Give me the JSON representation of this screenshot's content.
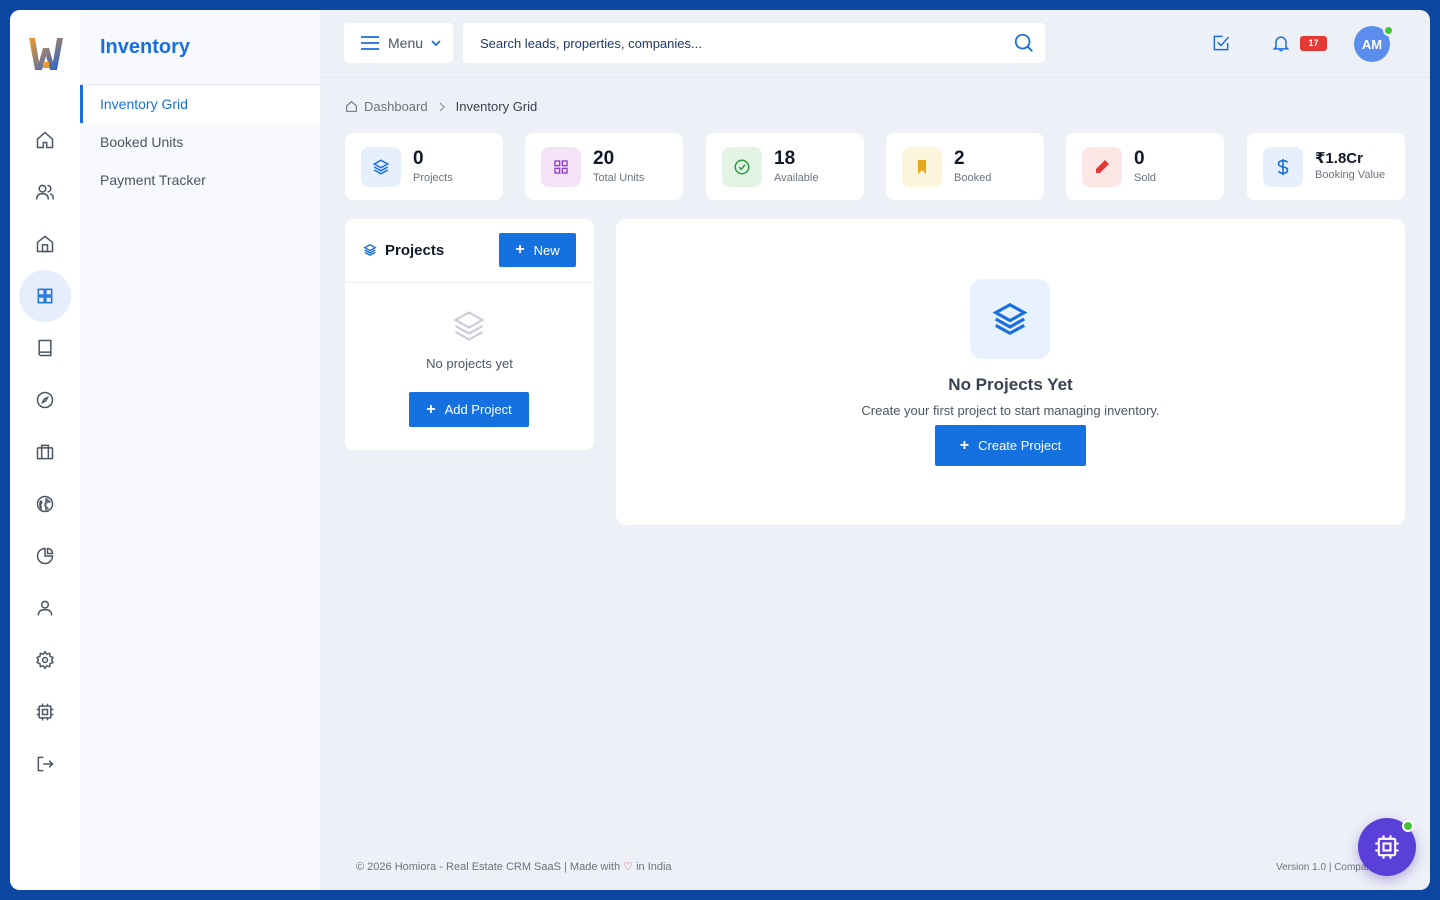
{
  "sidebar": {
    "items": [
      {
        "icon": "home-icon"
      },
      {
        "icon": "users-icon"
      },
      {
        "icon": "property-icon"
      },
      {
        "icon": "grid-icon"
      },
      {
        "icon": "book-icon"
      },
      {
        "icon": "compass-icon"
      },
      {
        "icon": "briefcase-icon"
      },
      {
        "icon": "globe-icon"
      },
      {
        "icon": "pie-chart-icon"
      },
      {
        "icon": "user-icon"
      },
      {
        "icon": "gear-icon"
      },
      {
        "icon": "chip-icon"
      },
      {
        "icon": "logout-icon"
      }
    ]
  },
  "subnav": {
    "title": "Inventory",
    "items": [
      {
        "label": "Inventory Grid"
      },
      {
        "label": "Booked Units"
      },
      {
        "label": "Payment Tracker"
      }
    ]
  },
  "topbar": {
    "menu_label": "Menu",
    "search_placeholder": "Search leads, properties, companies...",
    "notification_count": "17",
    "avatar_initials": "AM"
  },
  "breadcrumb": {
    "home": "Dashboard",
    "current": "Inventory Grid"
  },
  "stats": [
    {
      "value": "0",
      "label": "Projects",
      "icon": "layers-icon",
      "color": "#1a6fe0"
    },
    {
      "value": "20",
      "label": "Total Units",
      "icon": "grid-icon",
      "color": "#8e3bc9"
    },
    {
      "value": "18",
      "label": "Available",
      "icon": "check-circle-icon",
      "color": "#2e9a43"
    },
    {
      "value": "2",
      "label": "Booked",
      "icon": "bookmark-icon",
      "color": "#e6a817"
    },
    {
      "value": "0",
      "label": "Sold",
      "icon": "pen-icon",
      "color": "#e03a3a"
    },
    {
      "value": "₹1.8Cr",
      "label": "Booking Value",
      "icon": "dollar-icon",
      "color": "#1a6fe0"
    }
  ],
  "projects_panel": {
    "title": "Projects",
    "new_label": "New",
    "empty_text": "No projects yet",
    "add_label": "Add Project"
  },
  "empty_state": {
    "title": "No Projects Yet",
    "subtitle": "Create your first project to start managing inventory.",
    "button_label": "Create Project"
  },
  "footer": {
    "left_before": "© 2026 Homiora - Real Estate CRM SaaS | Made with",
    "left_after": "in India",
    "right": "Version 1.0 | Compan"
  },
  "colors": {
    "accent": "#1a6fe0",
    "frame": "#0d47a1",
    "fab": "#5b3fd9"
  }
}
